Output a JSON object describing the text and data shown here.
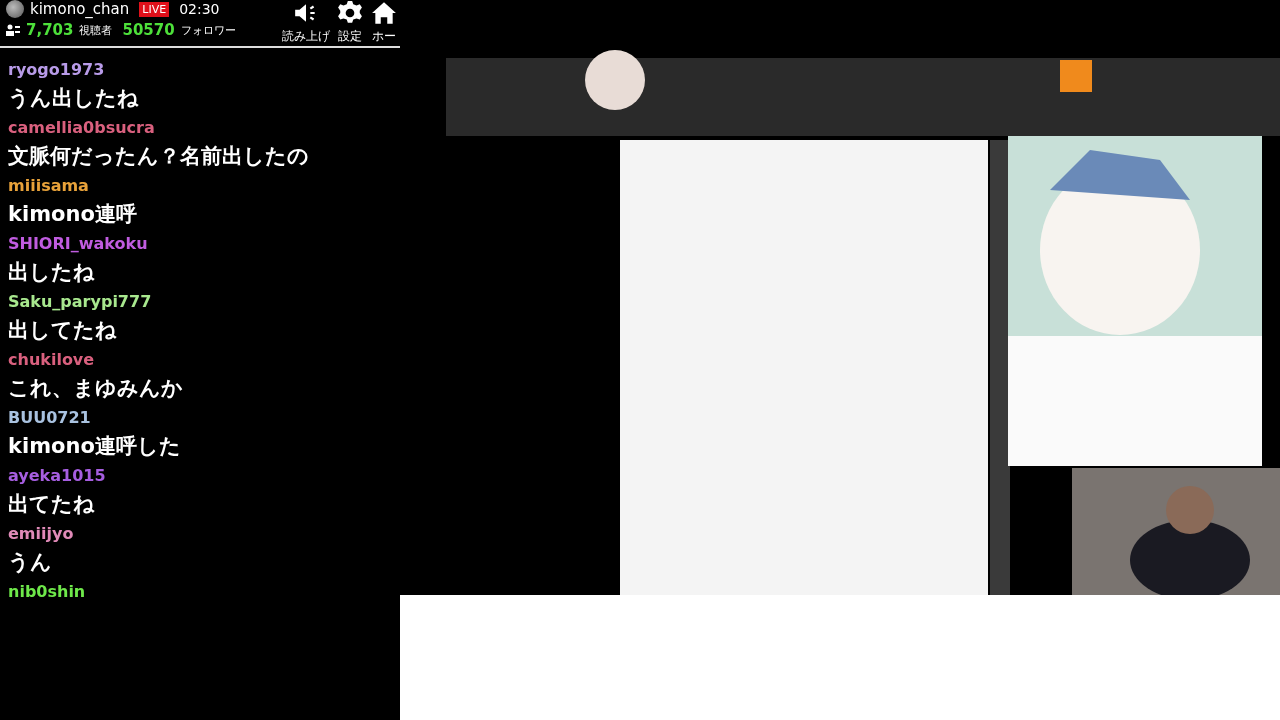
{
  "header": {
    "channel_name": "kimono_chan",
    "live_badge": "LIVE",
    "elapsed": "02:30",
    "viewers": "7,703",
    "viewers_label": "視聴者",
    "followers": "50570",
    "followers_label": "フォロワー",
    "buttons": [
      {
        "kind": "speaker",
        "label": "読み上げ"
      },
      {
        "kind": "gear",
        "label": "設定"
      },
      {
        "kind": "home",
        "label": "ホー"
      }
    ]
  },
  "chat": [
    {
      "user": "ryogo1973",
      "color": "#b89be8",
      "message": "うん出したね"
    },
    {
      "user": "camellia0bsucra",
      "color": "#d9607e",
      "message": "文脈何だったん？名前出したの"
    },
    {
      "user": "miiisama",
      "color": "#e8a23a",
      "message": "kimono連呼"
    },
    {
      "user": "SHIORI_wakoku",
      "color": "#c05ce0",
      "message": "出したね"
    },
    {
      "user": "Saku_parypi777",
      "color": "#a8e88e",
      "message": "出してたね"
    },
    {
      "user": "chukilove",
      "color": "#d9607e",
      "message": "これ、まゆみんか"
    },
    {
      "user": "BUU0721",
      "color": "#a9c2e0",
      "message": "kimono連呼した"
    },
    {
      "user": "ayeka1015",
      "color": "#a65ee0",
      "message": "出てたね"
    },
    {
      "user": "emiijyo",
      "color": "#e08ab8",
      "message": "うん"
    },
    {
      "user": "nib0shin",
      "color": "#6ee84a"
    }
  ]
}
